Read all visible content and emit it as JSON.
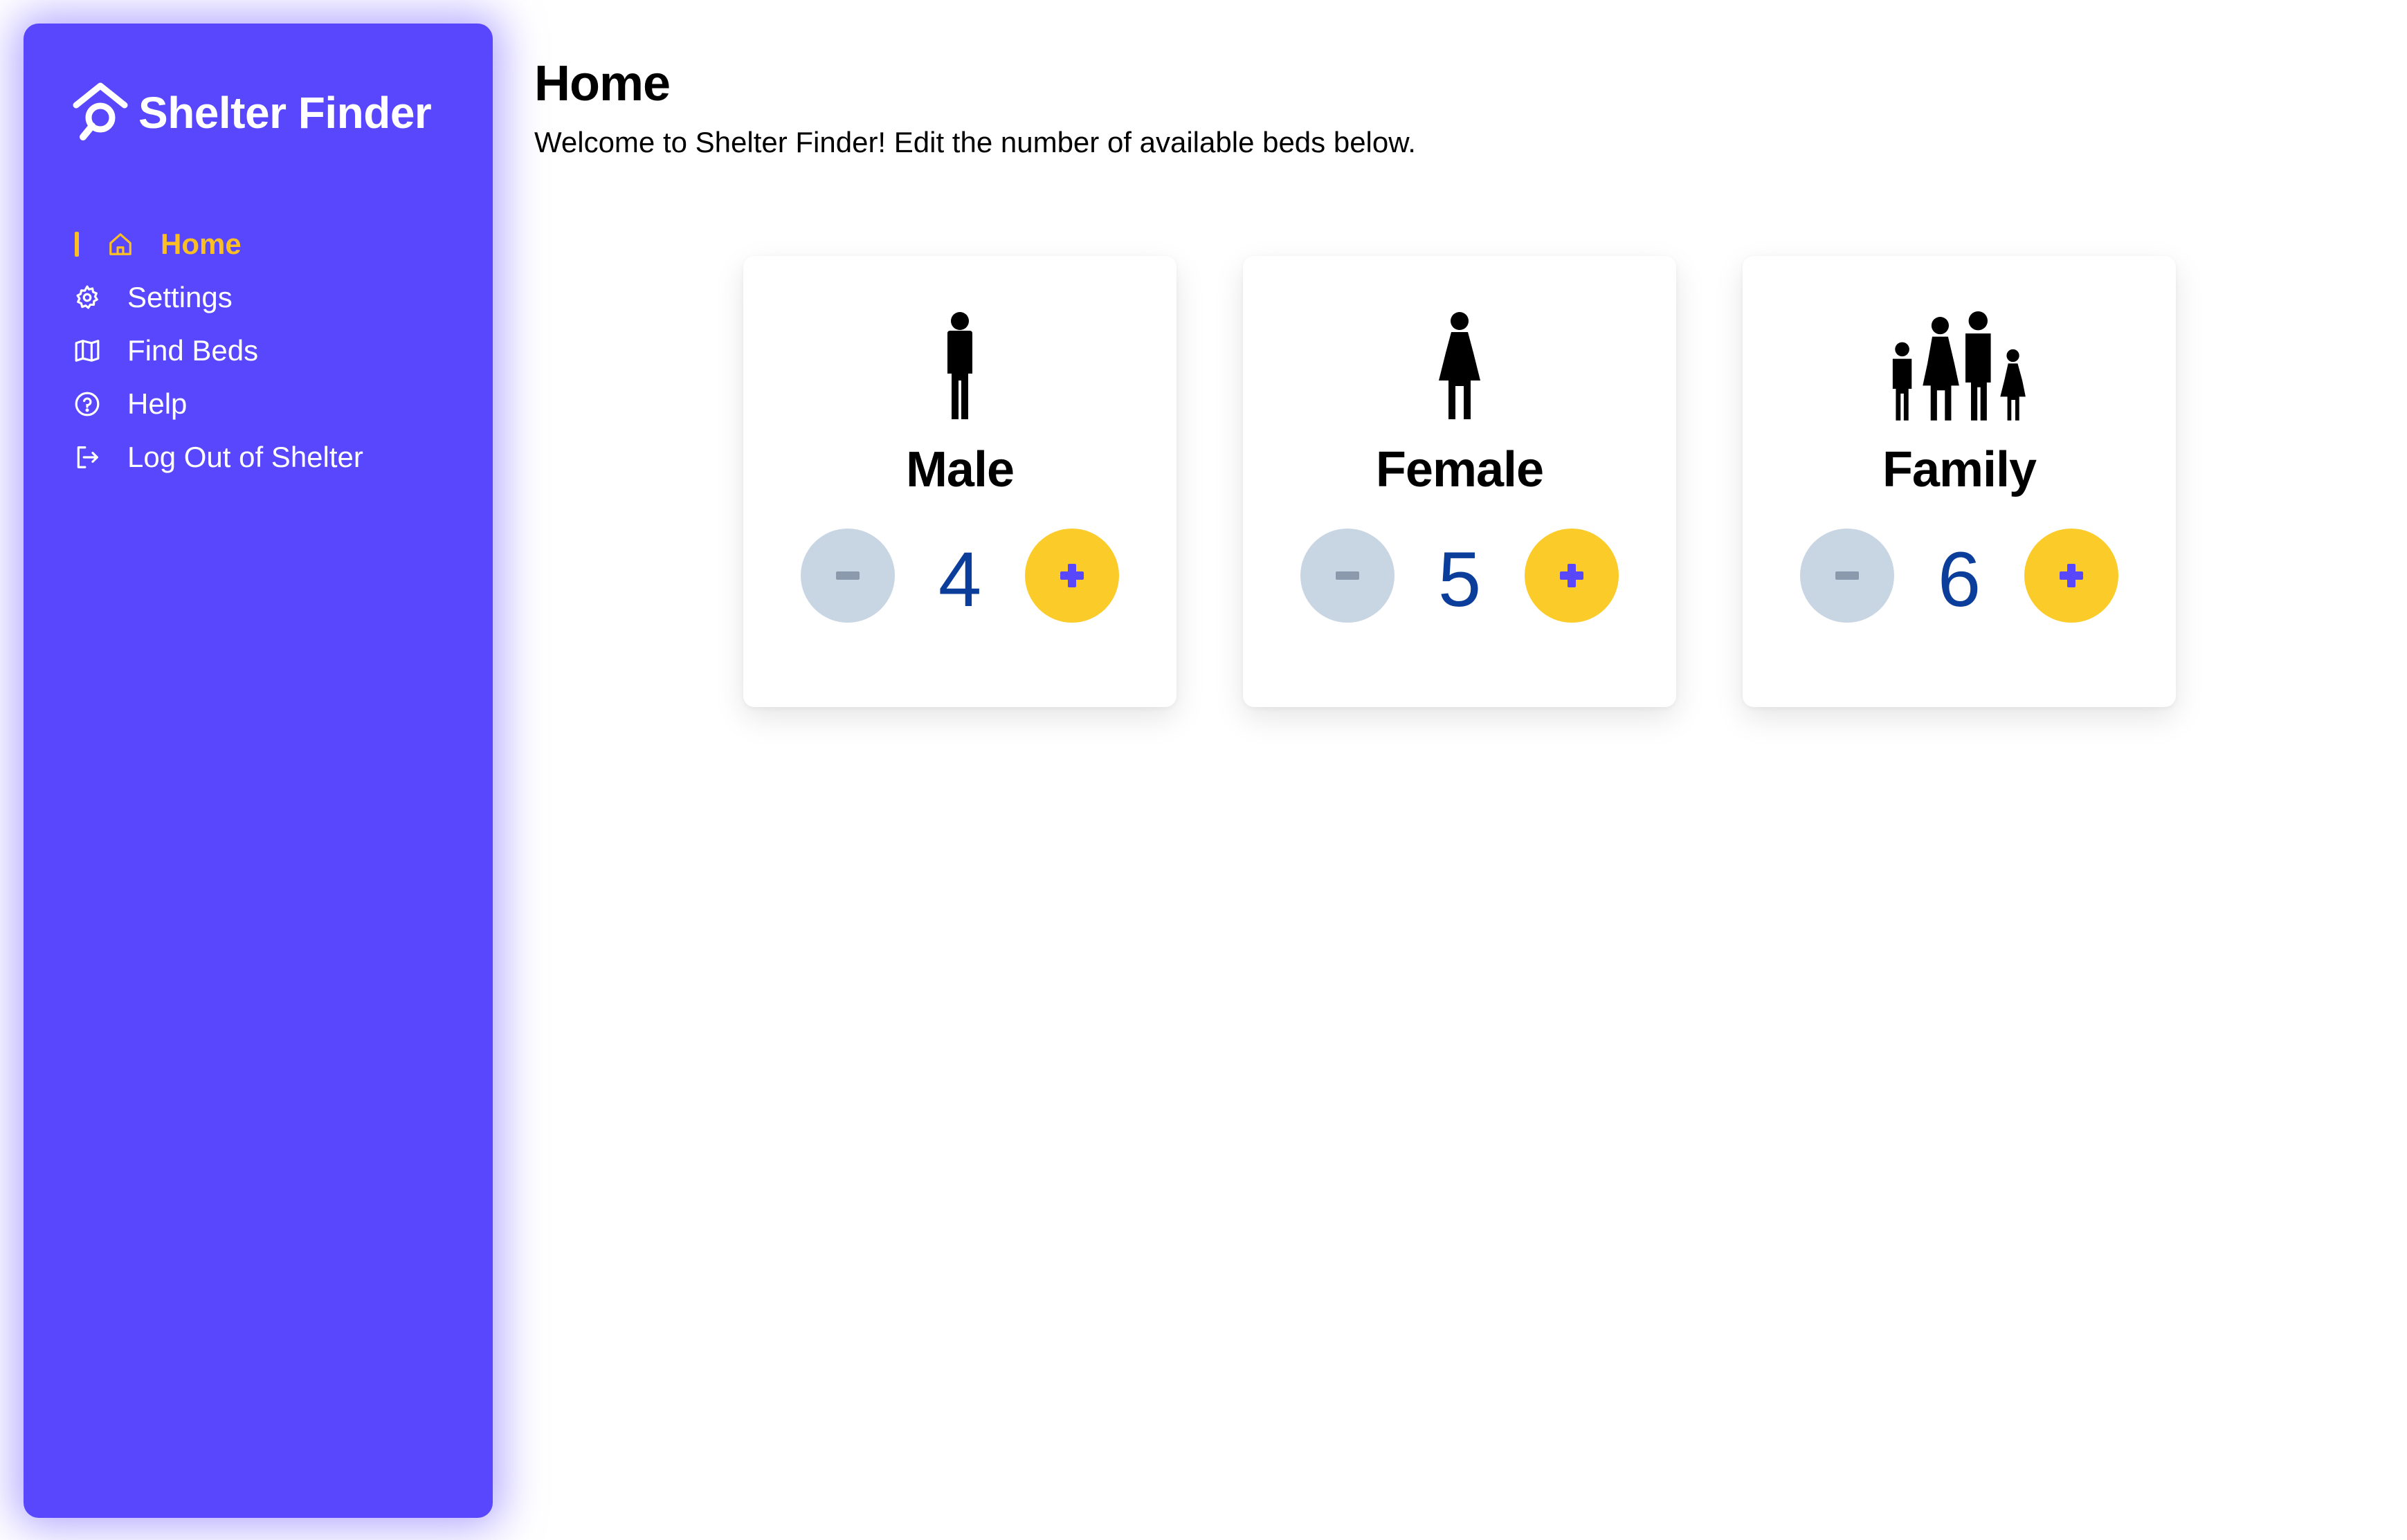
{
  "app": {
    "name": "Shelter Finder"
  },
  "sidebar": {
    "items": [
      {
        "label": "Home",
        "icon": "home-icon",
        "active": true
      },
      {
        "label": "Settings",
        "icon": "gear-icon",
        "active": false
      },
      {
        "label": "Find Beds",
        "icon": "map-icon",
        "active": false
      },
      {
        "label": "Help",
        "icon": "help-circle-icon",
        "active": false
      },
      {
        "label": "Log Out of Shelter",
        "icon": "logout-icon",
        "active": false
      }
    ]
  },
  "main": {
    "title": "Home",
    "subtitle": "Welcome to Shelter Finder! Edit the number of available beds below.",
    "cards": [
      {
        "label": "Male",
        "count": "4",
        "icon": "male-person-icon"
      },
      {
        "label": "Female",
        "count": "5",
        "icon": "female-person-icon"
      },
      {
        "label": "Family",
        "count": "6",
        "icon": "family-icon"
      }
    ]
  },
  "colors": {
    "sidebar_bg": "#5847fc",
    "accent": "#fbbf24",
    "plus_button": "#fbcb2a",
    "minus_button": "#c8d5e3",
    "count_text": "#0b3d9a",
    "plus_glyph": "#5847fc",
    "minus_glyph": "#8a9aac"
  }
}
